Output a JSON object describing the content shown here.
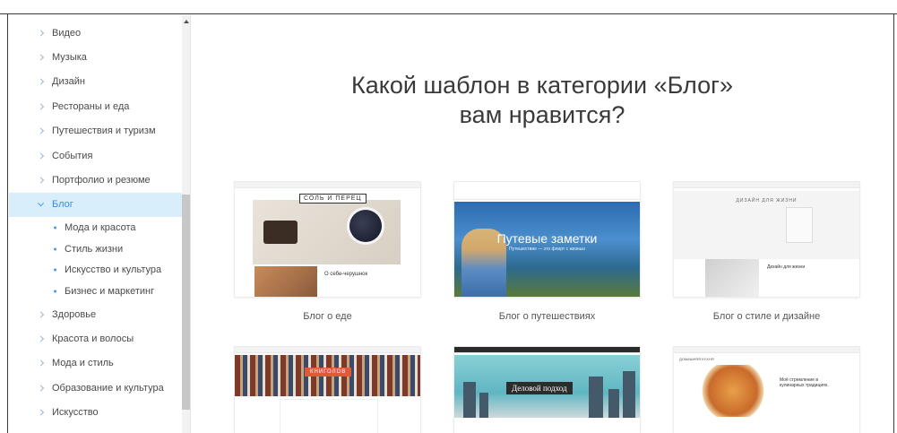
{
  "sidebar": {
    "items": [
      {
        "label": "Видео"
      },
      {
        "label": "Музыка"
      },
      {
        "label": "Дизайн"
      },
      {
        "label": "Рестораны и еда"
      },
      {
        "label": "Путешествия и туризм"
      },
      {
        "label": "События"
      },
      {
        "label": "Портфолио и резюме"
      },
      {
        "label": "Блог",
        "active": true
      },
      {
        "label": "Здоровье"
      },
      {
        "label": "Красота и волосы"
      },
      {
        "label": "Мода и стиль"
      },
      {
        "label": "Образование и культура"
      },
      {
        "label": "Искусство"
      }
    ],
    "sub_items": [
      {
        "label": "Мода и красота"
      },
      {
        "label": "Стиль жизни"
      },
      {
        "label": "Искусство и культура"
      },
      {
        "label": "Бизнес и маркетинг"
      }
    ]
  },
  "main": {
    "heading_line1": "Какой шаблон в категории «Блог»",
    "heading_line2": "вам нравится?",
    "templates": [
      {
        "caption": "Блог о еде",
        "thumb_text": "СОЛЬ И ПЕРЕЦ",
        "thumb_post": "О себе-черушнок"
      },
      {
        "caption": "Блог о путешествиях",
        "thumb_text": "Путевые заметки",
        "thumb_sub": "Путешествие — это флирт с жизнью"
      },
      {
        "caption": "Блог о стиле и дизайне",
        "thumb_text": "ДИЗАЙН ДЛЯ ЖИЗНИ",
        "thumb_post": "Дизайн для жизни"
      },
      {
        "caption": "",
        "thumb_text": "КНИГОЛОВ"
      },
      {
        "caption": "",
        "thumb_text": "Деловой подход"
      },
      {
        "caption": "",
        "thumb_text": "ДОМАШНЯЯ КУХНЯ",
        "thumb_post": "Моё стремление в кулинарных традициях."
      }
    ]
  },
  "colors": {
    "accent": "#3d8bd8",
    "active_bg": "#d9eefb",
    "text": "#4a4a4a",
    "heading": "#3a3a3a"
  }
}
